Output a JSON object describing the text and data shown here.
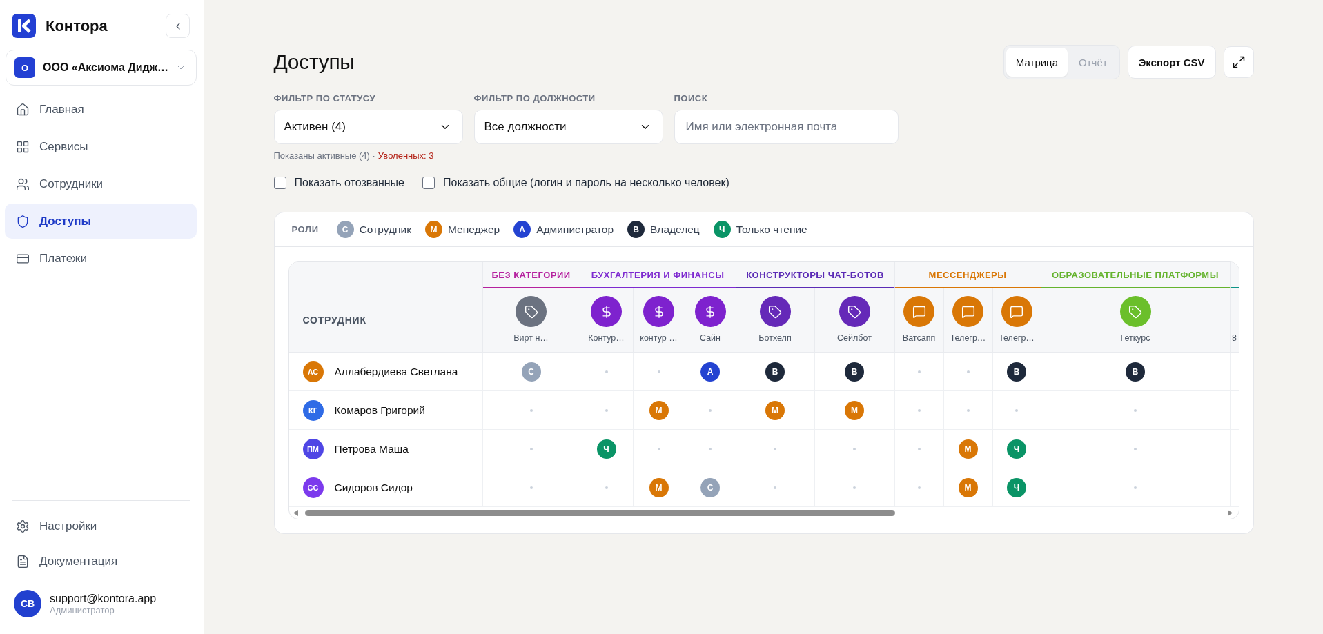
{
  "sidebar": {
    "brand": "Контора",
    "org": {
      "badge": "О",
      "name": "ООО «Аксиома Дидж…"
    },
    "nav": [
      {
        "kind": "home",
        "label": "Главная",
        "selected": false
      },
      {
        "kind": "services",
        "label": "Сервисы",
        "selected": false
      },
      {
        "kind": "employees",
        "label": "Сотрудники",
        "selected": false
      },
      {
        "kind": "access",
        "label": "Доступы",
        "selected": true
      },
      {
        "kind": "payments",
        "label": "Платежи",
        "selected": false
      }
    ],
    "footer_nav": [
      {
        "kind": "settings",
        "label": "Настройки"
      },
      {
        "kind": "docs",
        "label": "Документация"
      }
    ],
    "user": {
      "initials": "СВ",
      "email": "support@kontora.app",
      "role": "Администратор"
    }
  },
  "header": {
    "title": "Доступы",
    "view_tabs": [
      {
        "label": "Матрица",
        "selected": true
      },
      {
        "label": "Отчёт",
        "selected": false
      }
    ],
    "export_button": "Экспорт CSV"
  },
  "filters": [
    {
      "kind": "select",
      "label": "ФИЛЬТР ПО СТАТУСУ",
      "value": "Активен (4)"
    },
    {
      "kind": "select",
      "label": "ФИЛЬТР ПО ДОЛЖНОСТИ",
      "value": "Все должности"
    },
    {
      "kind": "search",
      "label": "ПОИСК",
      "placeholder": "Имя или электронная почта"
    }
  ],
  "status_hint": {
    "text": "Показаны активные (4) ·",
    "link": "Уволенных: 3"
  },
  "checkboxes": [
    {
      "label": "Показать отозванные",
      "checked": false
    },
    {
      "label": "Показать общие (логин и пароль на несколько человек)",
      "checked": false
    }
  ],
  "roles": {
    "label": "РОЛИ",
    "items": [
      {
        "letter": "С",
        "label": "Сотрудник",
        "color": "#94a3b8"
      },
      {
        "letter": "М",
        "label": "Менеджер",
        "color": "#d97706"
      },
      {
        "letter": "А",
        "label": "Администратор",
        "color": "#2443d1"
      },
      {
        "letter": "В",
        "label": "Владелец",
        "color": "#1e293b"
      },
      {
        "letter": "Ч",
        "label": "Только чтение",
        "color": "#0a9466"
      }
    ]
  },
  "table": {
    "employee_header": "СОТРУДНИК",
    "categories": [
      {
        "label": "БЕЗ КАТЕГОРИИ",
        "color": "#b5219f",
        "services": [
          {
            "kind": "tag",
            "label": "Вирт н…",
            "color": "#6b7280"
          }
        ]
      },
      {
        "label": "БУХГАЛТЕРИЯ И ФИНАНСЫ",
        "color": "#7e2ad0",
        "services": [
          {
            "kind": "dollar",
            "label": "Контур…",
            "color": "#7e22ce"
          },
          {
            "kind": "dollar",
            "label": "контур …",
            "color": "#7e22ce"
          },
          {
            "kind": "dollar",
            "label": "Сайн",
            "color": "#7e22ce"
          }
        ]
      },
      {
        "label": "КОНСТРУКТОРЫ ЧАТ-БОТОВ",
        "color": "#5b2bb5",
        "services": [
          {
            "kind": "tag",
            "label": "Ботхелп",
            "color": "#6529b8"
          },
          {
            "kind": "tag",
            "label": "Сейлбот",
            "color": "#6529b8"
          }
        ]
      },
      {
        "label": "МЕССЕНДЖЕРЫ",
        "color": "#d97706",
        "services": [
          {
            "kind": "chat",
            "label": "Ватсапп",
            "color": "#d97706"
          },
          {
            "kind": "chat",
            "label": "Телегр…",
            "color": "#d97706"
          },
          {
            "kind": "chat",
            "label": "Телегр…",
            "color": "#d97706"
          }
        ]
      },
      {
        "label": "ОБРАЗОВАТЕЛЬНЫЕ ПЛАТФОРМЫ",
        "color": "#65b32e",
        "services": [
          {
            "kind": "tag",
            "label": "Геткурс",
            "color": "#6bbf2b"
          }
        ]
      },
      {
        "color": "#0d9488",
        "services": [
          {
            "label": "8"
          }
        ]
      }
    ],
    "rows": [
      {
        "initials": "АС",
        "name": "Аллабердиева Светлана",
        "color": "#d97706",
        "cells": [
          {
            "kind": "role",
            "letter": "С",
            "color": "#94a3b8"
          },
          {
            "kind": "empty"
          },
          {
            "kind": "empty"
          },
          {
            "kind": "role",
            "letter": "А",
            "color": "#2443d1"
          },
          {
            "kind": "role",
            "letter": "В",
            "color": "#1e293b"
          },
          {
            "kind": "role",
            "letter": "В",
            "color": "#1e293b"
          },
          {
            "kind": "empty"
          },
          {
            "kind": "empty"
          },
          {
            "kind": "role",
            "letter": "В",
            "color": "#1e293b"
          },
          {
            "kind": "role",
            "letter": "В",
            "color": "#1e293b"
          }
        ]
      },
      {
        "initials": "КГ",
        "name": "Комаров Григорий",
        "color": "#2f6be6",
        "cells": [
          {
            "kind": "empty"
          },
          {
            "kind": "empty"
          },
          {
            "kind": "role",
            "letter": "М",
            "color": "#d97706"
          },
          {
            "kind": "empty"
          },
          {
            "kind": "role",
            "letter": "М",
            "color": "#d97706"
          },
          {
            "kind": "role",
            "letter": "М",
            "color": "#d97706"
          },
          {
            "kind": "empty"
          },
          {
            "kind": "empty"
          },
          {
            "kind": "empty"
          },
          {
            "kind": "empty"
          }
        ]
      },
      {
        "initials": "ПМ",
        "name": "Петрова Маша",
        "color": "#4f46e5",
        "cells": [
          {
            "kind": "empty"
          },
          {
            "kind": "role",
            "letter": "Ч",
            "color": "#0a9466"
          },
          {
            "kind": "empty"
          },
          {
            "kind": "empty"
          },
          {
            "kind": "empty"
          },
          {
            "kind": "empty"
          },
          {
            "kind": "empty"
          },
          {
            "kind": "role",
            "letter": "М",
            "color": "#d97706"
          },
          {
            "kind": "role",
            "letter": "Ч",
            "color": "#0a9466"
          },
          {
            "kind": "empty"
          }
        ]
      },
      {
        "initials": "СС",
        "name": "Сидоров Сидор",
        "color": "#7c3aed",
        "cells": [
          {
            "kind": "empty"
          },
          {
            "kind": "empty"
          },
          {
            "kind": "role",
            "letter": "М",
            "color": "#d97706"
          },
          {
            "kind": "role",
            "letter": "С",
            "color": "#94a3b8"
          },
          {
            "kind": "empty"
          },
          {
            "kind": "empty"
          },
          {
            "kind": "empty"
          },
          {
            "kind": "role",
            "letter": "М",
            "color": "#d97706"
          },
          {
            "kind": "role",
            "letter": "Ч",
            "color": "#0a9466"
          },
          {
            "kind": "empty"
          }
        ]
      }
    ]
  }
}
